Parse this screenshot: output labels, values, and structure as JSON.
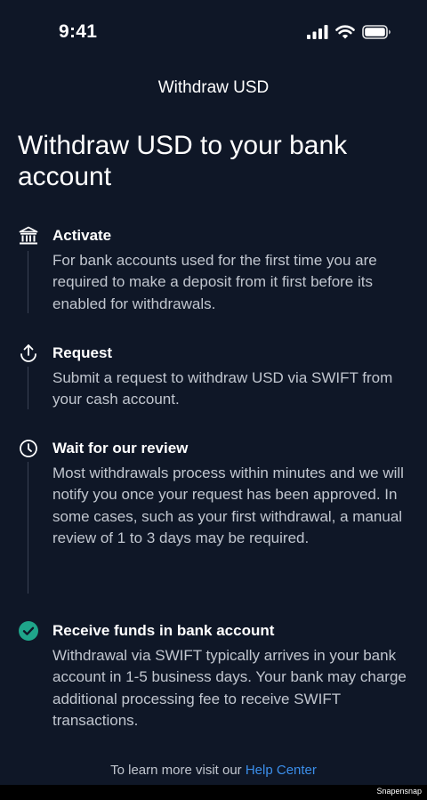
{
  "status_bar": {
    "time": "9:41"
  },
  "nav": {
    "title": "Withdraw USD"
  },
  "heading": "Withdraw USD to your bank account",
  "steps": [
    {
      "icon": "bank-icon",
      "title": "Activate",
      "description": "For bank accounts used for the first time you are required to make a deposit from it first before its enabled for withdrawals."
    },
    {
      "icon": "upload-icon",
      "title": "Request",
      "description": "Submit a request to withdraw USD via SWIFT from your cash account."
    },
    {
      "icon": "clock-icon",
      "title": "Wait for our review",
      "description": "Most withdrawals process within minutes and we will notify you once your request has been approved. In some cases, such as your first withdrawal, a manual review of 1 to 3 days may be required."
    },
    {
      "icon": "check-circle-icon",
      "title": "Receive funds in bank account",
      "description": "Withdrawal via SWIFT typically arrives in your bank account in 1-5 business days. Your bank may charge additional processing fee to receive SWIFT transactions."
    }
  ],
  "footer": {
    "text": "To learn more visit our",
    "link": "Help Center"
  },
  "watermark": "Snapensnap",
  "colors": {
    "background": "#0f1727",
    "accent": "#3b8eea",
    "check": "#1fa58a",
    "muted_text": "#c1c6cf"
  }
}
